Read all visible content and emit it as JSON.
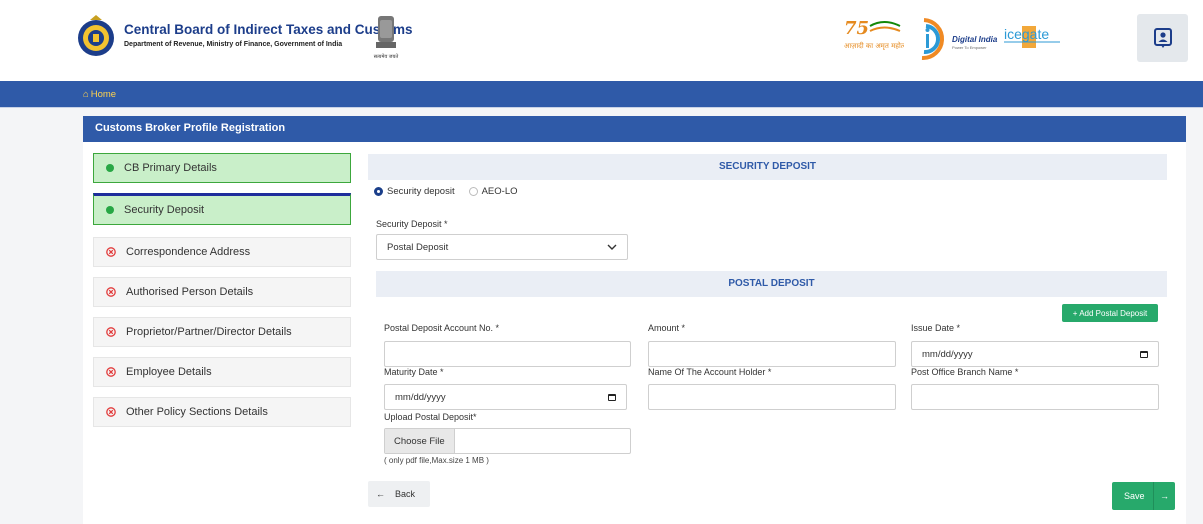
{
  "header": {
    "org_title": "Central Board of Indirect Taxes and Customs",
    "org_subtitle": "Department of Revenue, Ministry of Finance, Government of India",
    "emblem_caption": "सत्यमेव जयते",
    "azadi_text": "आज़ादी का अमृत महोत्सव",
    "digital_india_text": "Digital India",
    "icegate_text": "icegate"
  },
  "nav": {
    "home_label": "Home"
  },
  "panel": {
    "title": "Customs Broker Profile Registration"
  },
  "steps": [
    {
      "label": "CB Primary Details",
      "status": "done"
    },
    {
      "label": "Security Deposit",
      "status": "active"
    },
    {
      "label": "Correspondence Address",
      "status": "pending"
    },
    {
      "label": "Authorised Person Details",
      "status": "pending"
    },
    {
      "label": "Proprietor/Partner/Director Details",
      "status": "pending"
    },
    {
      "label": "Employee Details",
      "status": "pending"
    },
    {
      "label": "Other Policy Sections Details",
      "status": "pending"
    }
  ],
  "security_section": {
    "heading": "SECURITY DEPOSIT",
    "radio_options": [
      {
        "label": "Security deposit",
        "selected": true
      },
      {
        "label": "AEO-LO",
        "selected": false
      }
    ],
    "deposit_label": "Security Deposit *",
    "deposit_value": "Postal Deposit"
  },
  "postal_section": {
    "heading": "POSTAL DEPOSIT",
    "add_button": "+ Add Postal Deposit",
    "fields": {
      "account_no_label": "Postal Deposit Account No. *",
      "account_no_value": "",
      "amount_label": "Amount *",
      "amount_value": "",
      "issue_date_label": "Issue Date *",
      "issue_date_placeholder": "mm/dd/yyyy",
      "maturity_date_label": "Maturity Date *",
      "maturity_date_placeholder": "mm/dd/yyyy",
      "holder_label": "Name Of The Account Holder *",
      "holder_value": "",
      "branch_label": "Post Office Branch Name *",
      "branch_value": "",
      "upload_label": "Upload Postal Deposit*",
      "choose_file": "Choose File",
      "upload_hint": "( only pdf file,Max.size 1 MB )"
    }
  },
  "actions": {
    "back": "Back",
    "save": "Save"
  },
  "colors": {
    "primary": "#2f5aa8",
    "success": "#27a96b",
    "done_bg": "#c9efc9",
    "error": "#e23b3b",
    "home_link": "#ffd34d"
  }
}
